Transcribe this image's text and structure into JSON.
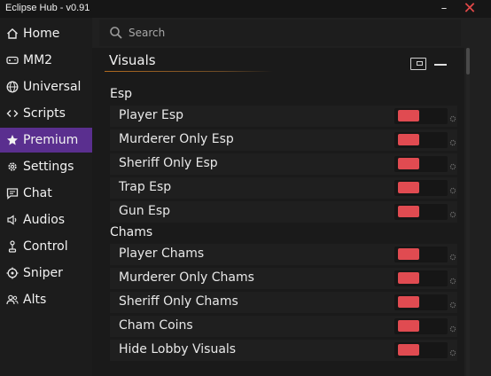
{
  "window": {
    "title": "Eclipse Hub - v0.91",
    "minimize_glyph": "–",
    "close_glyph": "✕"
  },
  "sidebar": {
    "items": [
      {
        "label": "Home",
        "icon": "home-icon",
        "active": false
      },
      {
        "label": "MM2",
        "icon": "gamepad-icon",
        "active": false
      },
      {
        "label": "Universal",
        "icon": "globe-icon",
        "active": false
      },
      {
        "label": "Scripts",
        "icon": "code-icon",
        "active": false
      },
      {
        "label": "Premium",
        "icon": "star-icon",
        "active": true
      },
      {
        "label": "Settings",
        "icon": "gear-icon",
        "active": false
      },
      {
        "label": "Chat",
        "icon": "chat-icon",
        "active": false
      },
      {
        "label": "Audios",
        "icon": "speaker-icon",
        "active": false
      },
      {
        "label": "Control",
        "icon": "joystick-icon",
        "active": false
      },
      {
        "label": "Sniper",
        "icon": "crosshair-icon",
        "active": false
      },
      {
        "label": "Alts",
        "icon": "users-icon",
        "active": false
      }
    ]
  },
  "search": {
    "placeholder": "Search",
    "value": ""
  },
  "panel": {
    "title": "Visuals",
    "sections": [
      {
        "label": "Esp",
        "rows": [
          {
            "label": "Player Esp",
            "enabled": false
          },
          {
            "label": "Murderer Only Esp",
            "enabled": false
          },
          {
            "label": "Sheriff Only Esp",
            "enabled": false
          },
          {
            "label": "Trap Esp",
            "enabled": false
          },
          {
            "label": "Gun Esp",
            "enabled": false
          }
        ]
      },
      {
        "label": "Chams",
        "rows": [
          {
            "label": "Player Chams",
            "enabled": false
          },
          {
            "label": "Murderer Only Chams",
            "enabled": false
          },
          {
            "label": "Sheriff Only Chams",
            "enabled": false
          },
          {
            "label": "Cham Coins",
            "enabled": false
          },
          {
            "label": "Hide Lobby Visuals",
            "enabled": false
          }
        ]
      }
    ]
  },
  "colors": {
    "accent_active": "#5a2f8f",
    "toggle_off": "#e04b51",
    "close": "#e24848",
    "underline": "#b06a20"
  }
}
